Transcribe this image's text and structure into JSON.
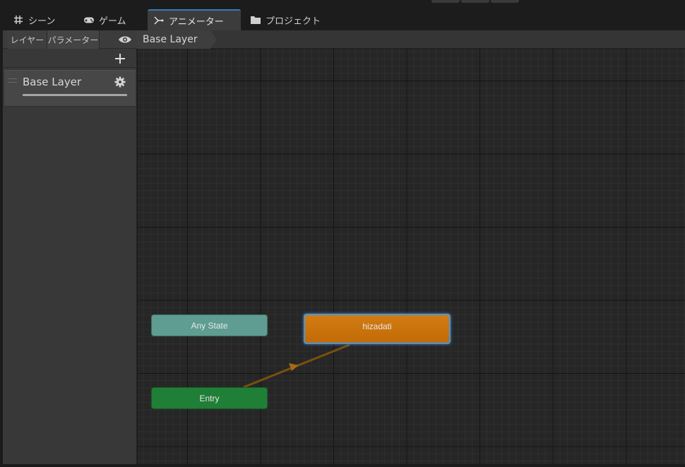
{
  "tabs": [
    {
      "label": "シーン",
      "icon": "grid-icon"
    },
    {
      "label": "ゲーム",
      "icon": "gamepad-icon"
    },
    {
      "label": "アニメーター",
      "icon": "animator-icon",
      "active": true
    },
    {
      "label": "プロジェクト",
      "icon": "folder-icon"
    }
  ],
  "left_panel": {
    "tabs": [
      "レイヤー",
      "パラメーター"
    ],
    "layers": [
      {
        "name": "Base Layer",
        "weight": 1.0
      }
    ]
  },
  "breadcrumb": [
    "Base Layer"
  ],
  "graph": {
    "states": {
      "any_state": "Any State",
      "entry": "Entry",
      "default_state": "hizadati"
    },
    "colors": {
      "any_state": "#5f9c92",
      "entry": "#1f7f36",
      "default_state": "#c97410",
      "selection": "#4c94d6",
      "transition": "#7a4f0f"
    }
  }
}
